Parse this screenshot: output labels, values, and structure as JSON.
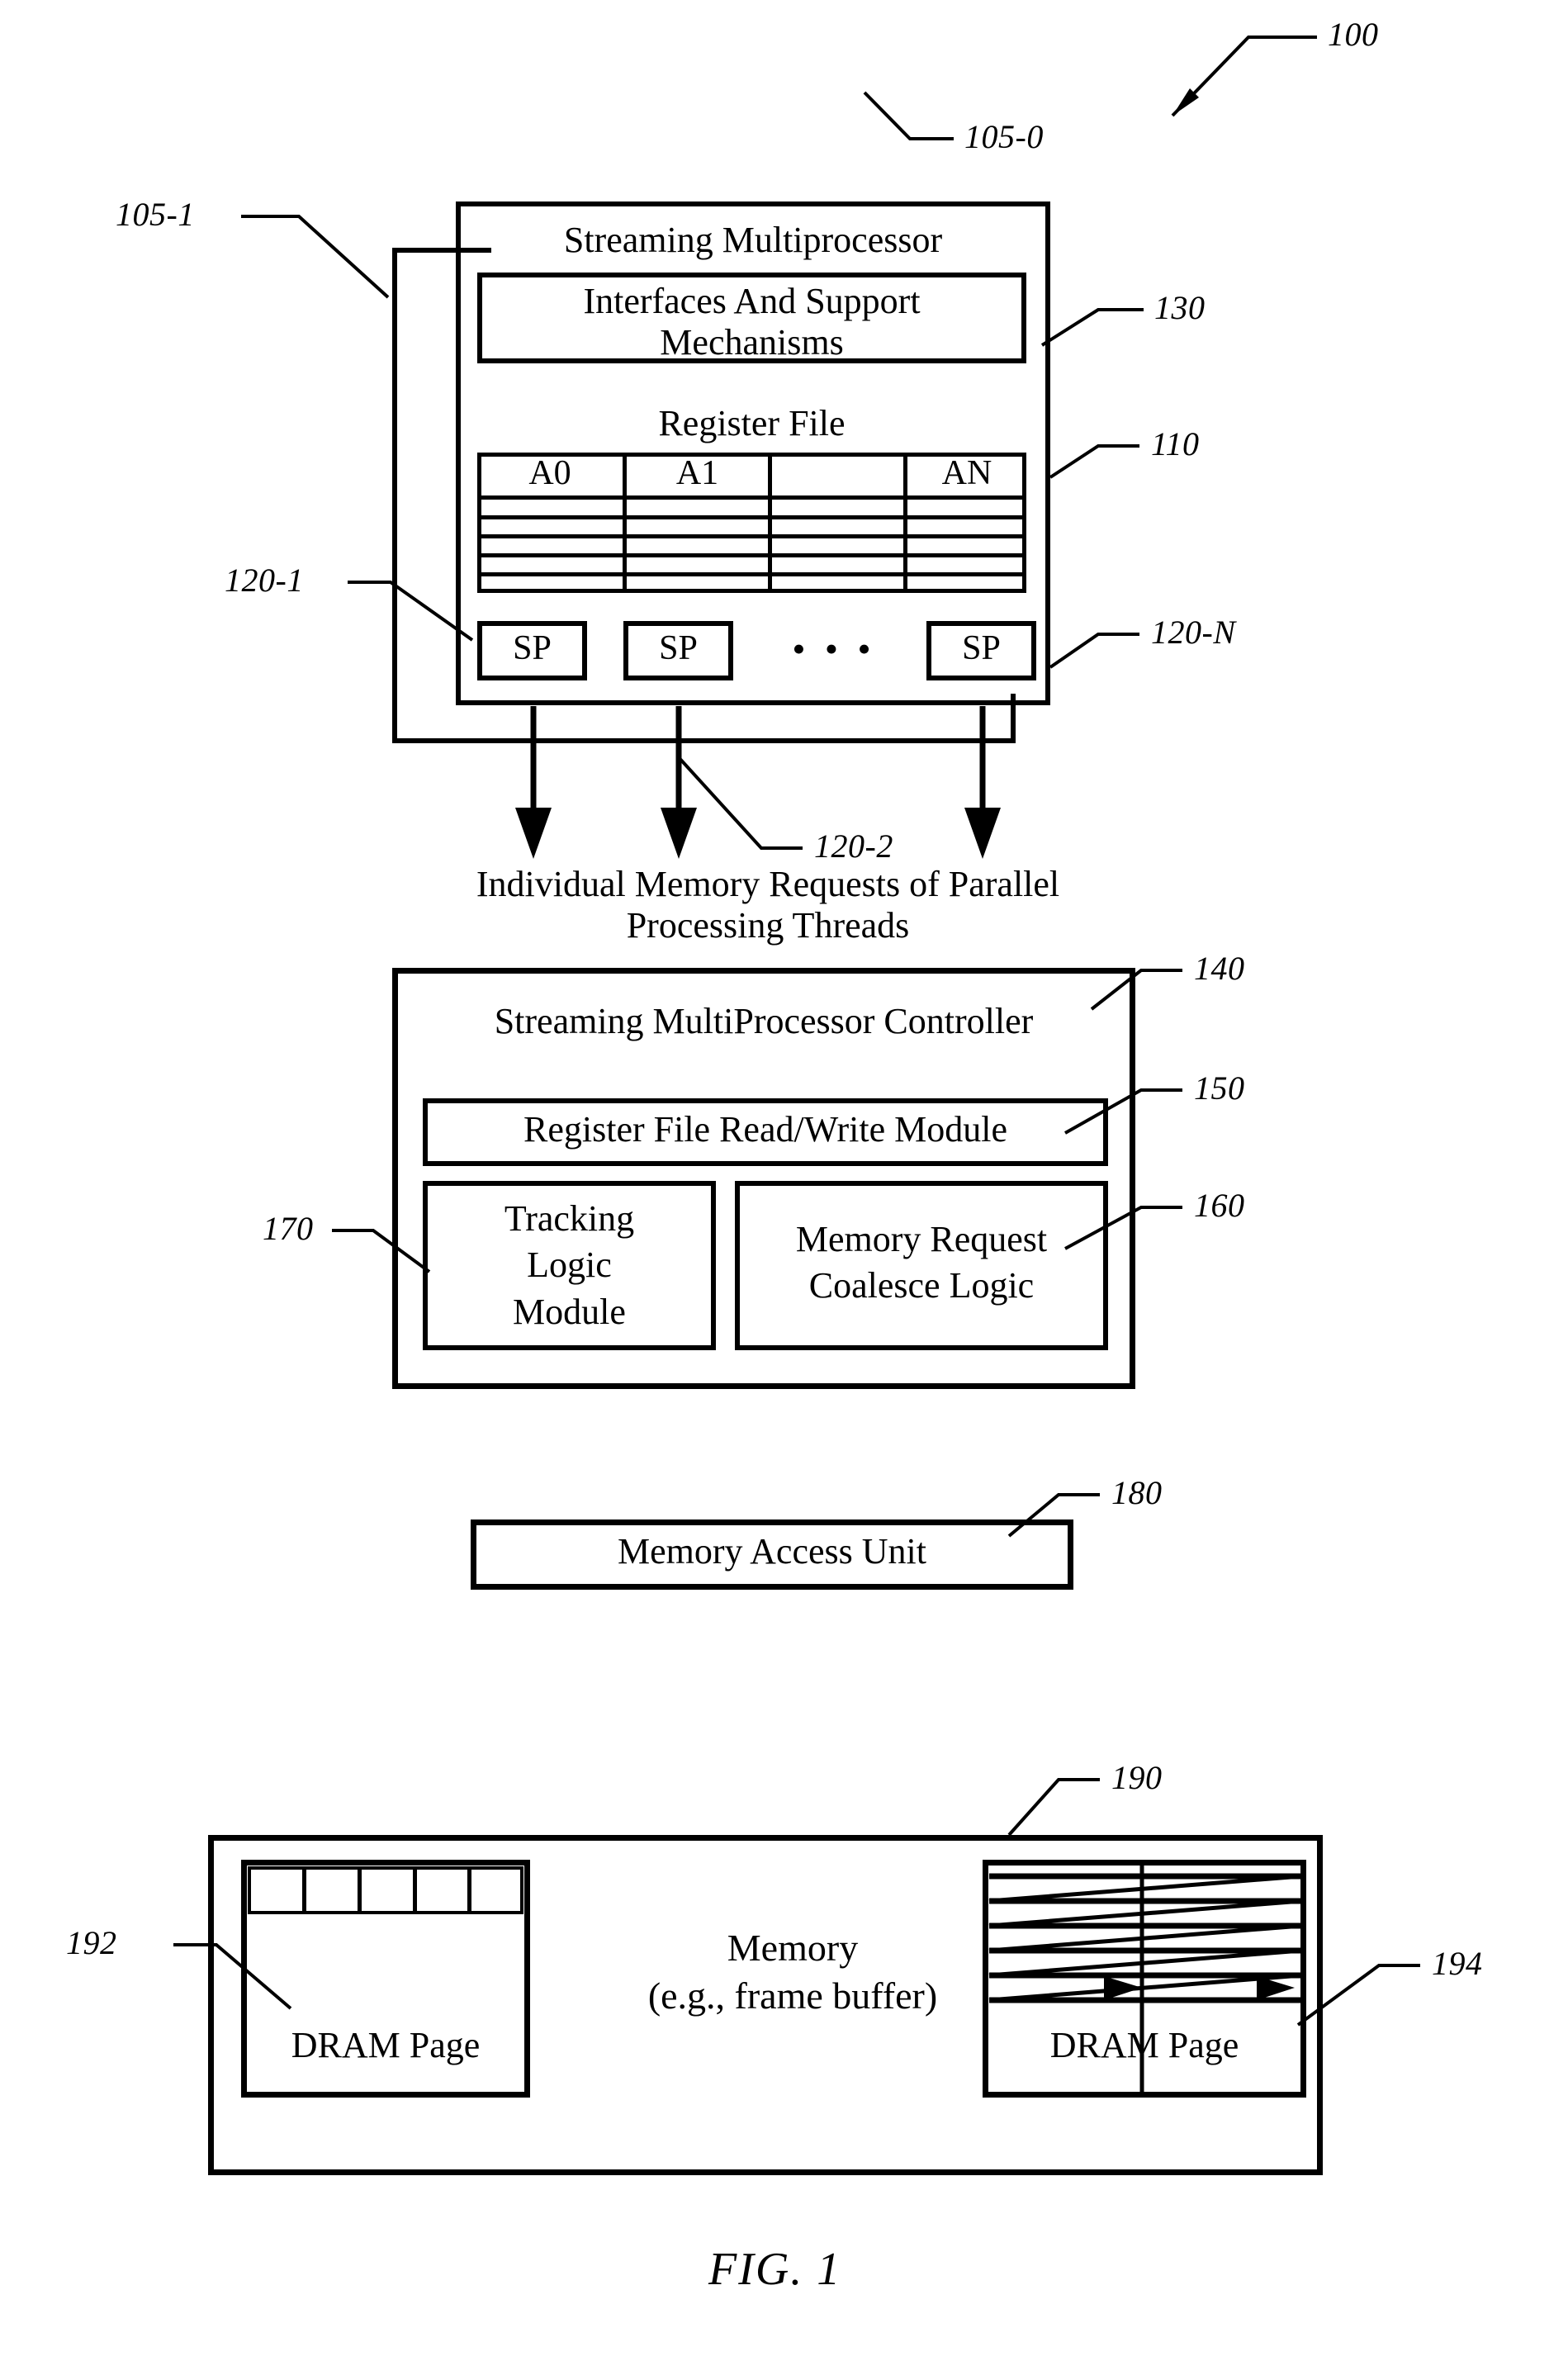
{
  "figure": {
    "caption": "FIG. 1",
    "top_ref": "100"
  },
  "sm": {
    "title": "Streaming Multiprocessor",
    "ref_front": "105-0",
    "ref_back": "105-1",
    "interfaces": {
      "label": "Interfaces And Support\nMechanisms",
      "ref": "130"
    },
    "register_file": {
      "title": "Register File",
      "ref": "110",
      "columns": [
        "A0",
        "A1",
        "",
        "AN"
      ],
      "row_count": 6
    },
    "sp_units": {
      "labels": [
        "SP",
        "SP",
        "SP"
      ],
      "ellipsis": "•  •  •",
      "ref_first": "120-1",
      "ref_second": "120-2",
      "ref_last": "120-N"
    }
  },
  "requests_label": "Individual Memory Requests of Parallel\nProcessing Threads",
  "controller": {
    "title": "Streaming MultiProcessor Controller",
    "ref": "140",
    "rf_rw_module": {
      "label": "Register File Read/Write Module",
      "ref": "150"
    },
    "tracking_logic": {
      "label": "Tracking\nLogic\nModule",
      "ref": "170"
    },
    "coalesce_logic": {
      "label": "Memory Request\nCoalesce Logic",
      "ref": "160"
    }
  },
  "memory_access_unit": {
    "label": "Memory Access Unit",
    "ref": "180"
  },
  "memory": {
    "label": "Memory\n(e.g., frame buffer)",
    "ref": "190",
    "left_page": {
      "label": "DRAM Page",
      "ref": "192",
      "cell_count": 5
    },
    "right_page": {
      "label": "DRAM Page",
      "ref": "194",
      "row_count": 6
    }
  },
  "colors": {
    "ink": "#000000",
    "paper": "#ffffff"
  }
}
